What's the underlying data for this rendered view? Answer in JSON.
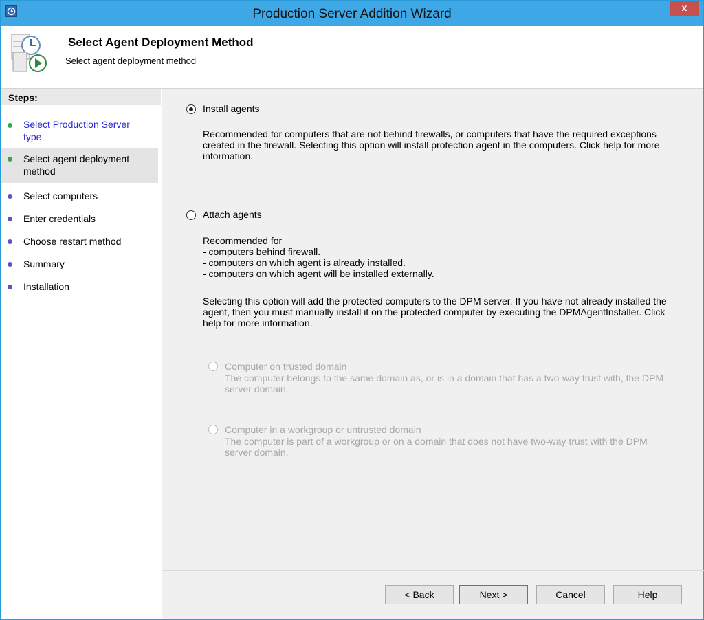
{
  "window": {
    "title": "Production Server Addition Wizard",
    "close_label": "x"
  },
  "header": {
    "title": "Select Agent Deployment Method",
    "subtitle": "Select agent deployment method"
  },
  "steps": {
    "heading": "Steps:",
    "items": [
      {
        "label": "Select Production Server type",
        "status": "completed"
      },
      {
        "label": "Select agent deployment method",
        "status": "current"
      },
      {
        "label": "Select computers",
        "status": "pending"
      },
      {
        "label": "Enter credentials",
        "status": "pending"
      },
      {
        "label": "Choose restart method",
        "status": "pending"
      },
      {
        "label": "Summary",
        "status": "pending"
      },
      {
        "label": "Installation",
        "status": "pending"
      }
    ]
  },
  "options": {
    "install": {
      "label": "Install agents",
      "selected": true,
      "description": "Recommended for computers that are not behind firewalls, or computers that have the required exceptions created in the firewall. Selecting this option will install protection agent in the computers. Click help for more information."
    },
    "attach": {
      "label": "Attach agents",
      "selected": false,
      "recommended_heading": "Recommended for",
      "recommended_items": [
        "- computers behind firewall.",
        "- computers on which agent is already installed.",
        "- computers on which agent will be installed externally."
      ],
      "description": "Selecting this option will add the protected computers to the DPM server. If you have not already installed the agent, then you must manually install it on the protected computer by executing the DPMAgentInstaller. Click help for more information.",
      "sub_options": [
        {
          "label": "Computer on trusted domain",
          "description": "The computer belongs to the same domain as, or is in a domain that has a two-way trust with, the DPM server domain.",
          "enabled": false
        },
        {
          "label": "Computer in a workgroup or untrusted domain",
          "description": "The computer is part of a workgroup or on a domain that does not have two-way trust with the DPM server domain.",
          "enabled": false
        }
      ]
    }
  },
  "buttons": {
    "back": "< Back",
    "next": "Next >",
    "cancel": "Cancel",
    "help": "Help"
  },
  "colors": {
    "titlebar": "#3ea7e6",
    "close": "#c75050",
    "link": "#2a2ad2",
    "completed_dot": "#33a94a",
    "pending_dot": "#5656c8"
  }
}
